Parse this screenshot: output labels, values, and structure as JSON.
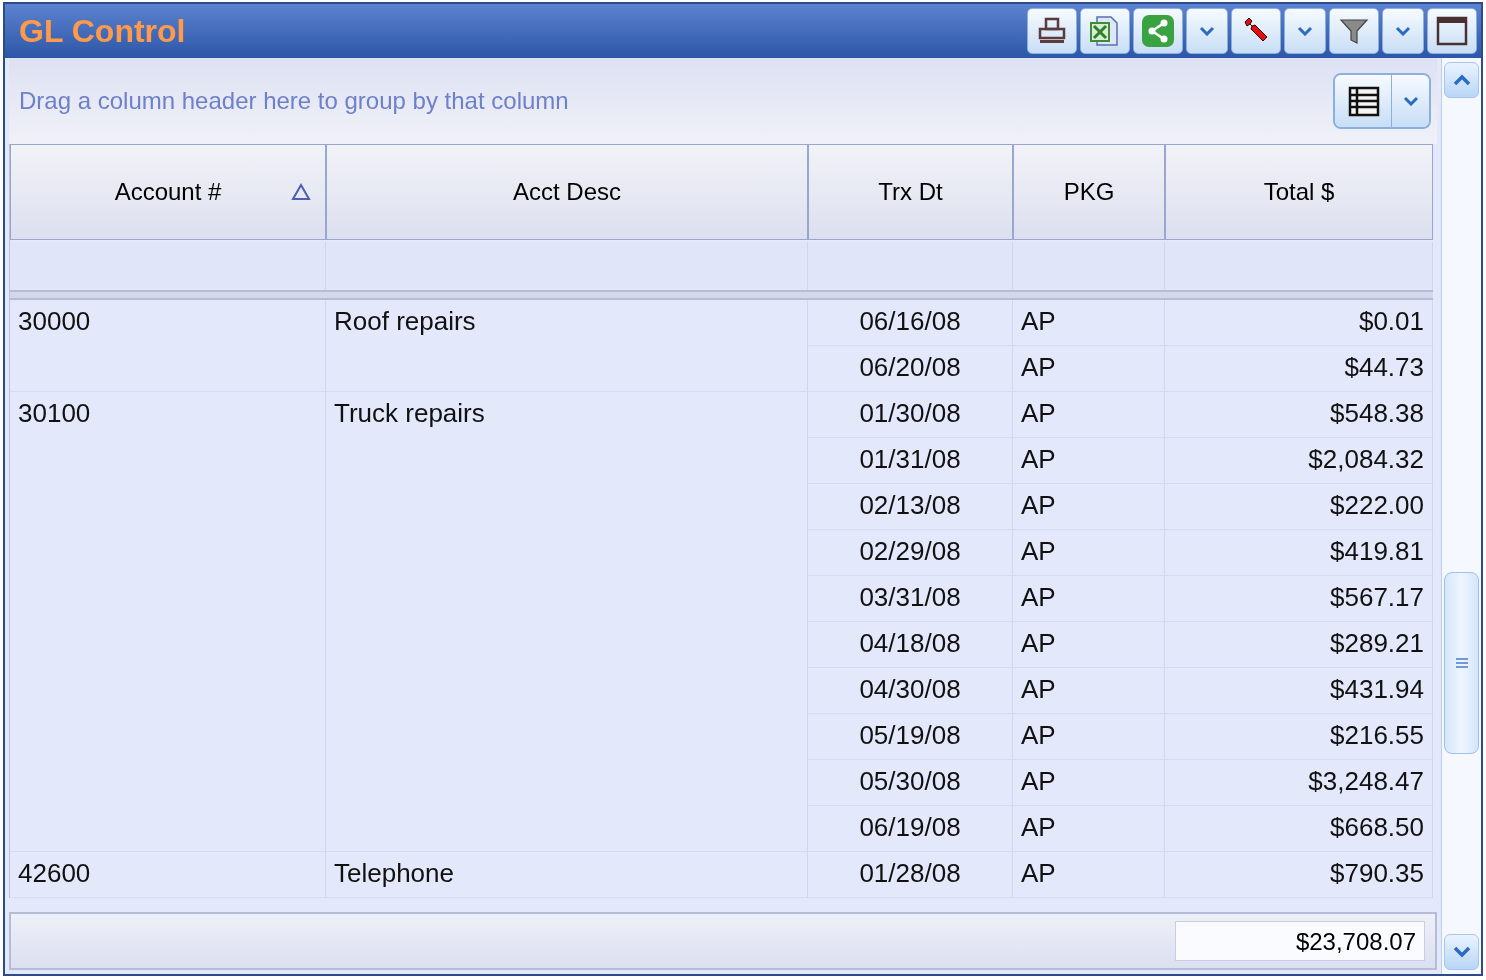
{
  "window": {
    "title": "GL Control"
  },
  "group_panel": {
    "hint": "Drag a column header here to group by that column"
  },
  "columns": [
    {
      "label": "Account #",
      "sorted": true
    },
    {
      "label": "Acct Desc",
      "sorted": false
    },
    {
      "label": "Trx Dt",
      "sorted": false
    },
    {
      "label": "PKG",
      "sorted": false
    },
    {
      "label": "Total $",
      "sorted": false
    }
  ],
  "groups": [
    {
      "account": "30000",
      "desc": "Roof repairs",
      "rows": [
        {
          "date": "06/16/08",
          "pkg": "AP",
          "total": "$0.01"
        },
        {
          "date": "06/20/08",
          "pkg": "AP",
          "total": "$44.73"
        }
      ]
    },
    {
      "account": "30100",
      "desc": "Truck repairs",
      "rows": [
        {
          "date": "01/30/08",
          "pkg": "AP",
          "total": "$548.38"
        },
        {
          "date": "01/31/08",
          "pkg": "AP",
          "total": "$2,084.32"
        },
        {
          "date": "02/13/08",
          "pkg": "AP",
          "total": "$222.00"
        },
        {
          "date": "02/29/08",
          "pkg": "AP",
          "total": "$419.81"
        },
        {
          "date": "03/31/08",
          "pkg": "AP",
          "total": "$567.17"
        },
        {
          "date": "04/18/08",
          "pkg": "AP",
          "total": "$289.21"
        },
        {
          "date": "04/30/08",
          "pkg": "AP",
          "total": "$431.94"
        },
        {
          "date": "05/19/08",
          "pkg": "AP",
          "total": "$216.55"
        },
        {
          "date": "05/30/08",
          "pkg": "AP",
          "total": "$3,248.47"
        },
        {
          "date": "06/19/08",
          "pkg": "AP",
          "total": "$668.50"
        }
      ]
    },
    {
      "account": "42600",
      "desc": "Telephone",
      "rows": [
        {
          "date": "01/28/08",
          "pkg": "AP",
          "total": "$790.35"
        }
      ]
    }
  ],
  "footer": {
    "total": "$23,708.07"
  }
}
